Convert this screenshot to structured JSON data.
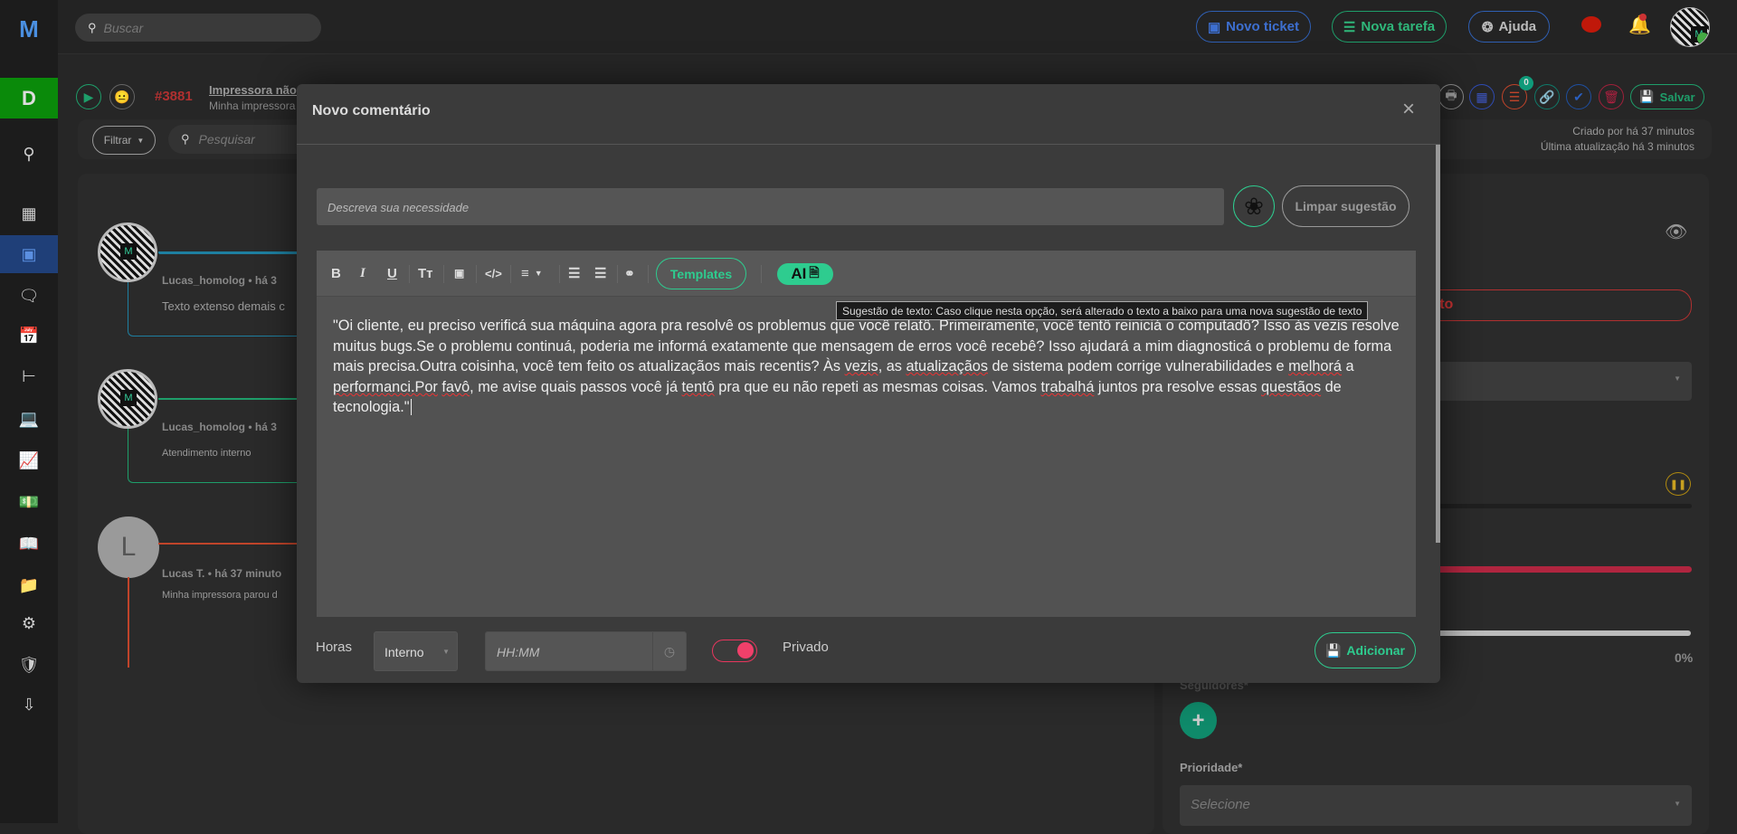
{
  "topbar": {
    "search_placeholder": "Buscar",
    "new_ticket": "Novo ticket",
    "new_task": "Nova tarefa",
    "help": "Ajuda"
  },
  "sidebar": {
    "workspace_letter": "D",
    "items": [
      "search",
      "dashboard",
      "tickets",
      "chat",
      "calendar",
      "hierarchy",
      "devices",
      "reports",
      "finance",
      "knowledge-base",
      "projects",
      "settings",
      "security",
      "downloads"
    ],
    "active": "tickets"
  },
  "ticket": {
    "number": "#3881",
    "title": "Impressora não i",
    "subtitle": "Minha impressora",
    "filter_label": "Filtrar",
    "search_placeholder": "Pesquisar",
    "tasks_badge": "0",
    "save_label": "Salvar",
    "created": "Criado por há 37 minutos",
    "updated": "Última atualização há 3 minutos"
  },
  "timeline": [
    {
      "author": "Lucas_homolog",
      "time": "há 3",
      "text": "Texto extenso demais c",
      "color": "#1e7fa0"
    },
    {
      "author": "Lucas_homolog",
      "time": "há 3",
      "text": "Atendimento interno",
      "color": "#1e9e6a"
    },
    {
      "author": "Lucas T.",
      "time": "há 37 minuto",
      "text": "Minha impressora parou d",
      "color": "#c0442a",
      "initial": "L"
    }
  ],
  "right_panel": {
    "contract_text": "ntrato",
    "progress_percent": "0%",
    "progress_value": 0,
    "followers_label": "Seguidores*",
    "priority_label": "Prioridade*",
    "priority_placeholder": "Selecione"
  },
  "modal": {
    "title": "Novo comentário",
    "ai_prompt_placeholder": "Descreva sua necessidade",
    "clear_suggestion": "Limpar sugestão",
    "templates_label": "Templates",
    "ai_label": "AI",
    "tooltip": "Sugestão de texto: Caso clique nesta opção, será alterado o texto a baixo para uma nova sugestão de texto",
    "body_segments": [
      {
        "t": "\"Oi cliente, eu preciso verificá sua máquina agora pra resolvê os problemus que você relatô. Primeiramente, você tentô reiniciá o computadô? Isso às vezis resolve muitus bugs.Se o problemu continuá, poderia me informá exatamente que mensagem de erros você recebê? Isso ajudará a mim diagnosticá o problemu de forma mais precisa.Outra coisinha, você tem feito os atualizaçãos mais recentis? Às "
      },
      {
        "t": "vezis",
        "err": true
      },
      {
        "t": ", as "
      },
      {
        "t": "atualizaçãos",
        "err": true
      },
      {
        "t": " de sistema podem corrige vulnerabilidades e "
      },
      {
        "t": "melhorá",
        "err": true
      },
      {
        "t": " a "
      },
      {
        "t": "performanci.Por",
        "err": true
      },
      {
        "t": " "
      },
      {
        "t": "favô",
        "err": true
      },
      {
        "t": ", me avise quais passos você já "
      },
      {
        "t": "tentô",
        "err": true
      },
      {
        "t": " pra que eu não repeti as mesmas coisas. Vamos "
      },
      {
        "t": "trabalhá",
        "err": true
      },
      {
        "t": " juntos pra resolve essas "
      },
      {
        "t": "questãos",
        "err": true
      },
      {
        "t": " de tecnologia.\""
      }
    ],
    "hours_label": "Horas",
    "hours_type": "Interno",
    "time_placeholder": "HH:MM",
    "private_label": "Privado",
    "private_on": true,
    "add_label": "Adicionar"
  },
  "colors": {
    "accent_green": "#2ecc8f",
    "blue": "#2f5fb3",
    "red": "#e8365d",
    "sidebar_active": "#1f3f78"
  }
}
